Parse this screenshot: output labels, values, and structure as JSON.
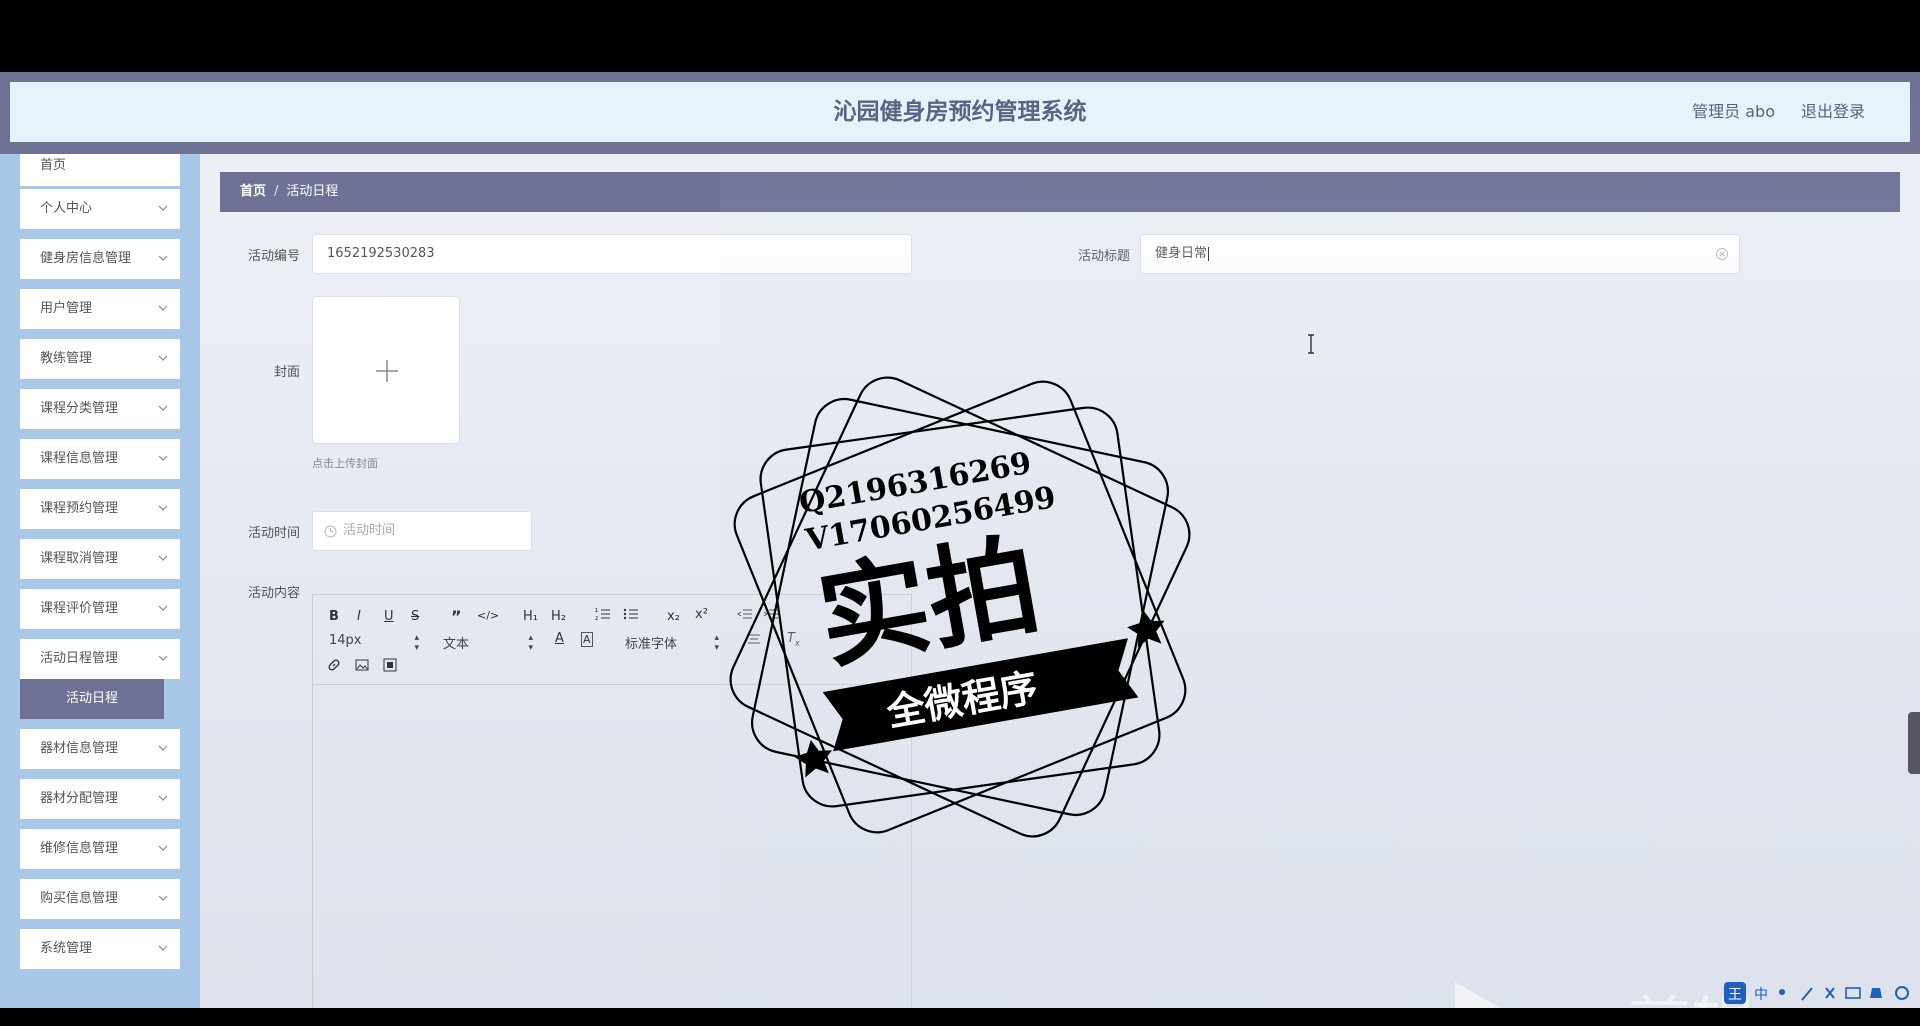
{
  "app": {
    "title": "沁园健身房预约管理系统",
    "user": "管理员 abo",
    "logout": "退出登录"
  },
  "sidebar": {
    "items": [
      {
        "label": "首页"
      },
      {
        "label": "个人中心"
      },
      {
        "label": "健身房信息管理"
      },
      {
        "label": "用户管理"
      },
      {
        "label": "教练管理"
      },
      {
        "label": "课程分类管理"
      },
      {
        "label": "课程信息管理"
      },
      {
        "label": "课程预约管理"
      },
      {
        "label": "课程取消管理"
      },
      {
        "label": "课程评价管理"
      },
      {
        "label": "活动日程管理"
      },
      {
        "label": "器材信息管理"
      },
      {
        "label": "器材分配管理"
      },
      {
        "label": "维修信息管理"
      },
      {
        "label": "购买信息管理"
      },
      {
        "label": "系统管理"
      }
    ],
    "active_sub": "活动日程"
  },
  "breadcrumb": {
    "home": "首页",
    "sep": "/",
    "current": "活动日程"
  },
  "form": {
    "id_label": "活动编号",
    "id_value": "1652192530283",
    "title_label": "活动标题",
    "title_value": "健身日常",
    "cover_label": "封面",
    "cover_hint": "点击上传封面",
    "time_label": "活动时间",
    "time_placeholder": "活动时间",
    "content_label": "活动内容"
  },
  "editor": {
    "font_size": "14px",
    "block_type": "文本",
    "font_family": "标准字体",
    "bold": "B",
    "italic": "I",
    "underline": "U",
    "strike": "S",
    "h1": "H₁",
    "h2": "H₂",
    "sub": "x₂",
    "sup": "x²",
    "font_color": "A"
  },
  "watermark": {
    "line1": "Q2196316269",
    "line2": "V17060256499",
    "main": "实拍",
    "banner": "全微程序",
    "ev": "ev剪辑"
  },
  "ime": {
    "zh": "中"
  }
}
